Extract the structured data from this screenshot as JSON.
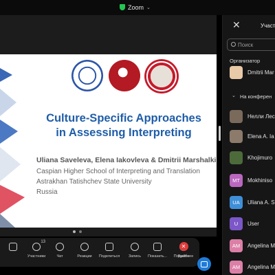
{
  "window": {
    "app_name": "Zoom"
  },
  "slide": {
    "title": "Culture-Specific Approaches in Assessing Interpreting",
    "authors": "Uliana Saveleva, Elena Iakovleva & Dmitrii Marshalkin",
    "affiliations": [
      "Caspian Higher School of Interpreting and Translation",
      "Astrakhan Tatishchev State University",
      "Russia"
    ],
    "page_count": 2,
    "current_page": 1
  },
  "toolbar": {
    "items": [
      {
        "label": "",
        "icon": "mic-icon"
      },
      {
        "label": "Участники",
        "icon": "participants-icon",
        "count": "13"
      },
      {
        "label": "Чат",
        "icon": "chat-icon"
      },
      {
        "label": "Реакции",
        "icon": "heart-icon"
      },
      {
        "label": "Поделиться",
        "icon": "share-icon"
      },
      {
        "label": "Запись",
        "icon": "record-icon"
      },
      {
        "label": "Показать...",
        "icon": "captions-icon"
      },
      {
        "label": "Подробнее",
        "icon": "more-icon"
      }
    ],
    "end_label": "Выйти"
  },
  "panel": {
    "title": "Участ",
    "search_placeholder": "Поиск",
    "section_organizer": "Организатор",
    "section_conference": "На конферен",
    "organizer": {
      "name": "Dmitrii Mar",
      "initials": "",
      "color": "#e8c9a8"
    },
    "participants": [
      {
        "name": "Нелли Лес",
        "initials": "",
        "color": "#7a6a5c"
      },
      {
        "name": "Elena A. Ia",
        "initials": "",
        "color": "#8c7a6a"
      },
      {
        "name": "Khojimuro",
        "initials": "",
        "color": "#4d6b3a"
      },
      {
        "name": "Mokhiniso",
        "initials": "MT",
        "color": "#b967bf"
      },
      {
        "name": "Uliana A. S",
        "initials": "UA",
        "color": "#3f8fd8"
      },
      {
        "name": "User",
        "initials": "U",
        "color": "#7b57c8"
      },
      {
        "name": "Angelina M",
        "initials": "AM",
        "color": "#dc7fa7"
      },
      {
        "name": "Angelina M",
        "initials": "AM",
        "color": "#dc7fa7"
      }
    ]
  }
}
